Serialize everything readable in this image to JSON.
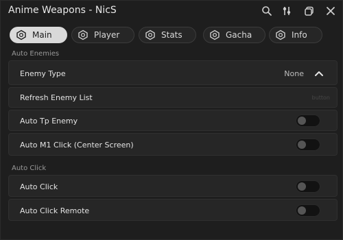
{
  "window": {
    "title": "Anime Weapons - NicS"
  },
  "titlebar_icons": [
    "search-icon",
    "settings-sliders-icon",
    "minimize-icon",
    "close-icon"
  ],
  "tabs": [
    {
      "label": "Main",
      "active": true
    },
    {
      "label": "Player",
      "active": false
    },
    {
      "label": "Stats",
      "active": false
    },
    {
      "label": "Gacha",
      "active": false
    },
    {
      "label": "Info",
      "active": false
    }
  ],
  "sections": {
    "auto_enemies": {
      "label": "Auto Enemies",
      "enemy_type": {
        "label": "Enemy Type",
        "value": "None"
      },
      "refresh": {
        "label": "Refresh Enemy List",
        "hint": "button"
      },
      "auto_tp": {
        "label": "Auto Tp Enemy",
        "on": false
      },
      "auto_m1": {
        "label": "Auto M1 Click (Center Screen)",
        "on": false
      }
    },
    "auto_click": {
      "label": "Auto Click",
      "auto_click": {
        "label": "Auto Click",
        "on": false
      },
      "auto_click_remote": {
        "label": "Auto Click Remote",
        "on": false
      }
    }
  },
  "colors": {
    "background": "#1e1e1e",
    "row": "#262626",
    "active_tab": "#d9d9d9",
    "toggle_off": "#121212"
  }
}
